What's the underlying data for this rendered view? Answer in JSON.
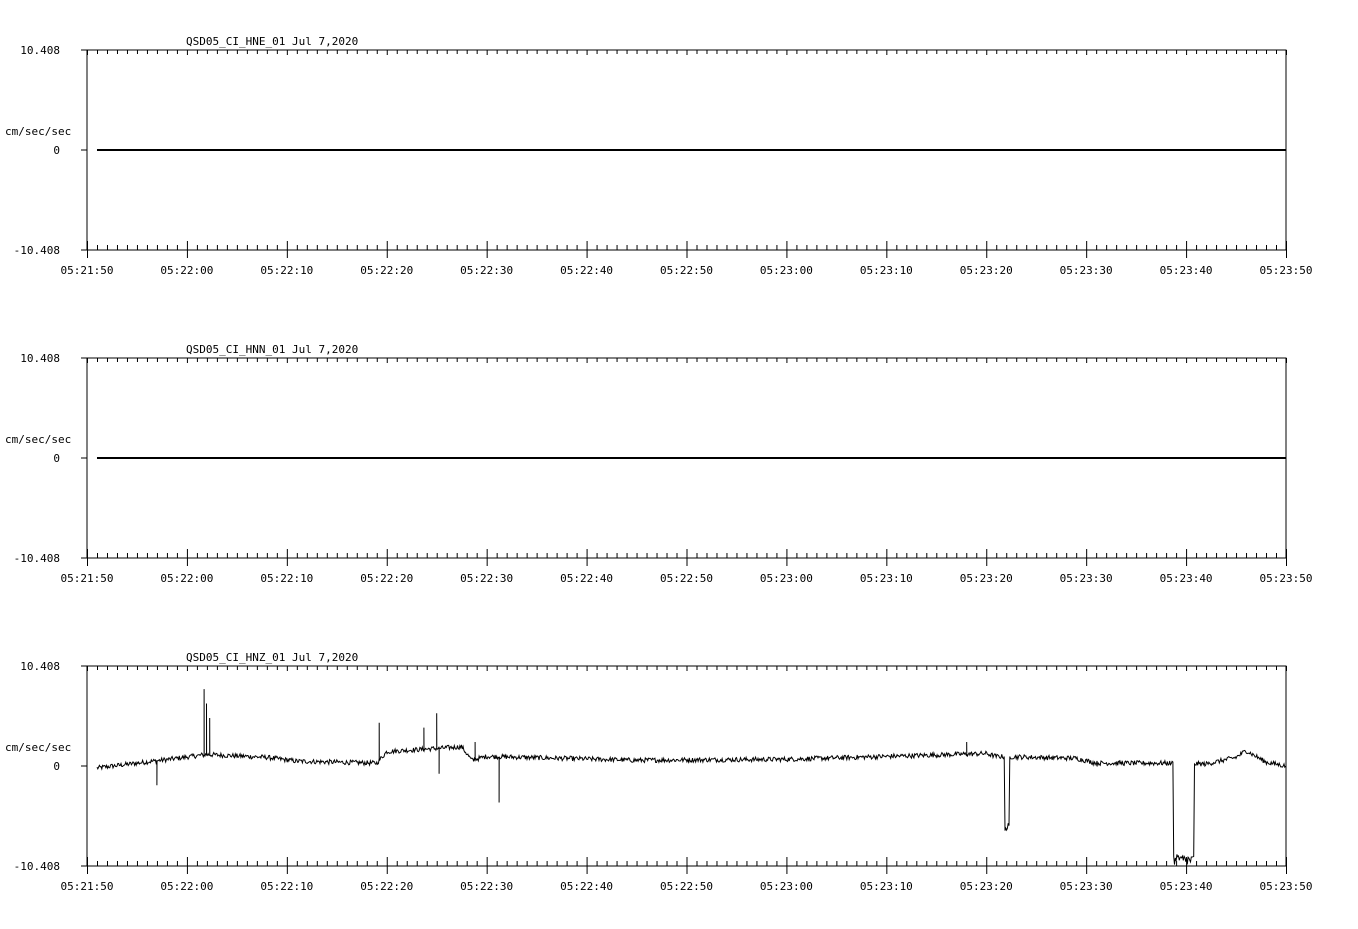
{
  "chart_data": [
    {
      "type": "line",
      "title": "QSD05_CI_HNE_01  Jul 7,2020",
      "ylabel": "cm/sec/sec",
      "ylim": [
        -10.408,
        10.408
      ],
      "y_tick_labels": [
        "10.408",
        "0",
        "-10.408"
      ],
      "x_tick_labels": [
        "05:21:50",
        "05:22:00",
        "05:22:10",
        "05:22:20",
        "05:22:30",
        "05:22:40",
        "05:22:50",
        "05:23:00",
        "05:23:10",
        "05:23:20",
        "05:23:30",
        "05:23:40",
        "05:23:50"
      ],
      "x_range_seconds": [
        0,
        120
      ],
      "trace": {
        "start_seconds": 1.0,
        "end_seconds": 120,
        "value": 0,
        "noise": 0,
        "events": []
      }
    },
    {
      "type": "line",
      "title": "QSD05_CI_HNN_01  Jul 7,2020",
      "ylabel": "cm/sec/sec",
      "ylim": [
        -10.408,
        10.408
      ],
      "y_tick_labels": [
        "10.408",
        "0",
        "-10.408"
      ],
      "x_tick_labels": [
        "05:21:50",
        "05:22:00",
        "05:22:10",
        "05:22:20",
        "05:22:30",
        "05:22:40",
        "05:22:50",
        "05:23:00",
        "05:23:10",
        "05:23:20",
        "05:23:30",
        "05:23:40",
        "05:23:50"
      ],
      "x_range_seconds": [
        0,
        120
      ],
      "trace": {
        "start_seconds": 1.0,
        "end_seconds": 120,
        "value": 0,
        "noise": 0,
        "events": []
      }
    },
    {
      "type": "line",
      "title": "QSD05_CI_HNZ_01  Jul 7,2020",
      "ylabel": "cm/sec/sec",
      "ylim": [
        -10.408,
        10.408
      ],
      "y_tick_labels": [
        "10.408",
        "0",
        "-10.408"
      ],
      "x_tick_labels": [
        "05:21:50",
        "05:22:00",
        "05:22:10",
        "05:22:20",
        "05:22:30",
        "05:22:40",
        "05:22:50",
        "05:23:00",
        "05:23:10",
        "05:23:20",
        "05:23:30",
        "05:23:40",
        "05:23:50"
      ],
      "x_range_seconds": [
        0,
        120
      ],
      "trace": {
        "start_seconds": 1.0,
        "end_seconds": 120,
        "noise": 0.25,
        "baseline": [
          [
            1.0,
            -0.2
          ],
          [
            5.0,
            0.3
          ],
          [
            9.0,
            0.8
          ],
          [
            12.0,
            1.2
          ],
          [
            18.0,
            0.9
          ],
          [
            21.0,
            0.5
          ],
          [
            29.0,
            0.3
          ],
          [
            30.0,
            1.5
          ],
          [
            37.5,
            2.0
          ],
          [
            38.5,
            0.6
          ],
          [
            40.0,
            1.0
          ],
          [
            55.0,
            0.6
          ],
          [
            70.0,
            0.7
          ],
          [
            90.0,
            1.3
          ],
          [
            91.0,
            1.0
          ],
          [
            99.0,
            0.8
          ],
          [
            101.0,
            0.3
          ],
          [
            108.5,
            0.3
          ],
          [
            112.0,
            0.2
          ],
          [
            115.0,
            0.9
          ],
          [
            116.0,
            1.6
          ],
          [
            118.0,
            0.4
          ],
          [
            120.0,
            0.0
          ]
        ],
        "events": [
          {
            "type": "spike",
            "t": 11.7,
            "value": 8.0
          },
          {
            "type": "spike",
            "t": 12.0,
            "value": 6.5
          },
          {
            "type": "spike",
            "t": 12.3,
            "value": 5.0
          },
          {
            "type": "spike",
            "t": 7.0,
            "value": -2.0
          },
          {
            "type": "spike",
            "t": 29.2,
            "value": 4.5
          },
          {
            "type": "spike",
            "t": 33.7,
            "value": 4.0
          },
          {
            "type": "spike",
            "t": 35.0,
            "value": 5.5
          },
          {
            "type": "spike",
            "t": 35.2,
            "value": -0.8
          },
          {
            "type": "spike",
            "t": 41.2,
            "value": -3.8
          },
          {
            "type": "spike",
            "t": 38.8,
            "value": 2.5
          },
          {
            "type": "spike",
            "t": 88.0,
            "value": 2.5
          },
          {
            "type": "dip",
            "t0": 91.8,
            "t1": 92.3,
            "value": -6.5
          },
          {
            "type": "dip",
            "t0": 108.7,
            "t1": 110.8,
            "value": -9.8
          }
        ]
      }
    }
  ]
}
